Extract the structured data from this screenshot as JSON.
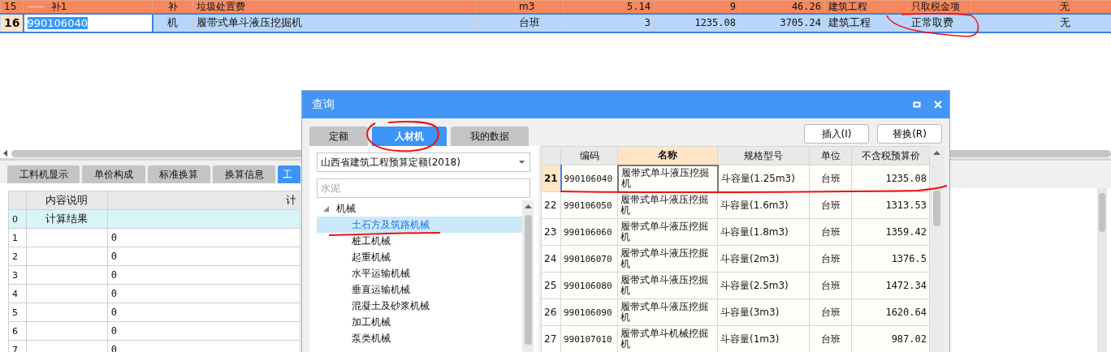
{
  "top_table": {
    "rows": [
      {
        "row_number": "15",
        "code": "补1",
        "type": "补",
        "name": "垃圾处置费",
        "unit": "m3",
        "quantity": "5.14",
        "unit_price": "9",
        "total": "46.26",
        "category": "建筑工程",
        "fee_mode": "只取税金项",
        "column_12": "无",
        "selected": false
      },
      {
        "row_number": "16",
        "code": "990106040",
        "type": "机",
        "name": "履带式单斗液压挖掘机",
        "unit": "台班",
        "quantity": "3",
        "unit_price": "1235.08",
        "total": "3705.24",
        "category": "建筑工程",
        "fee_mode": "正常取费",
        "column_12": "无",
        "selected": true
      }
    ]
  },
  "bottom_panel": {
    "tabs": [
      {
        "label": "工料机显示",
        "selected": false
      },
      {
        "label": "单价构成",
        "selected": false
      },
      {
        "label": "标准换算",
        "selected": false
      },
      {
        "label": "换算信息",
        "selected": false
      },
      {
        "label": "工",
        "selected": true
      }
    ],
    "table": {
      "columns": [
        "内容说明",
        "计"
      ],
      "rows": [
        {
          "row_number": "0",
          "description": "计算结果",
          "highlighted": true
        },
        {
          "row_number": "1",
          "value": "0",
          "highlighted": false
        },
        {
          "row_number": "2",
          "value": "0",
          "highlighted": false
        },
        {
          "row_number": "3",
          "value": "0",
          "highlighted": false
        },
        {
          "row_number": "4",
          "value": "0",
          "highlighted": false
        },
        {
          "row_number": "5",
          "value": "0",
          "highlighted": false
        },
        {
          "row_number": "6",
          "value": "0",
          "highlighted": false
        },
        {
          "row_number": "7",
          "value": "0",
          "highlighted": false
        }
      ]
    }
  },
  "dialog": {
    "title": "查询",
    "tabs": [
      {
        "label": "定额",
        "selected": false
      },
      {
        "label": "人材机",
        "selected": true
      },
      {
        "label": "我的数据",
        "selected": false
      }
    ],
    "buttons": [
      "插入(I)",
      "替换(R)"
    ],
    "library": "山西省建筑工程预算定额(2018)",
    "search": {
      "placeholder": "水泥"
    },
    "tree": [
      {
        "label": "机械",
        "expanded": true,
        "children": [
          {
            "label": "土石方及筑路机械",
            "selected": true
          },
          {
            "label": "桩工机械",
            "selected": false
          },
          {
            "label": "起重机械",
            "selected": false
          },
          {
            "label": "水平运输机械",
            "selected": false
          },
          {
            "label": "垂直运输机械",
            "selected": false
          },
          {
            "label": "混凝土及砂浆机械",
            "selected": false
          },
          {
            "label": "加工机械",
            "selected": false
          },
          {
            "label": "泵类机械",
            "selected": false
          }
        ]
      }
    ],
    "table": {
      "columns": [
        {
          "label": "编码",
          "selected": false
        },
        {
          "label": "名称",
          "selected": true
        },
        {
          "label": "规格型号",
          "selected": false
        },
        {
          "label": "单位",
          "selected": false
        },
        {
          "label": "不含税预算价",
          "selected": false
        }
      ],
      "rows": [
        {
          "row_number": "21",
          "code": "990106040",
          "name": "履带式单斗液压挖掘机",
          "spec": "斗容量(1.25m3)",
          "unit": "台班",
          "price": "1235.08",
          "selected": true
        },
        {
          "row_number": "22",
          "code": "990106050",
          "name": "履带式单斗液压挖掘机",
          "spec": "斗容量(1.6m3)",
          "unit": "台班",
          "price": "1313.53",
          "selected": false
        },
        {
          "row_number": "23",
          "code": "990106060",
          "name": "履带式单斗液压挖掘机",
          "spec": "斗容量(1.8m3)",
          "unit": "台班",
          "price": "1359.42",
          "selected": false
        },
        {
          "row_number": "24",
          "code": "990106070",
          "name": "履带式单斗液压挖掘机",
          "spec": "斗容量(2m3)",
          "unit": "台班",
          "price": "1376.5",
          "selected": false
        },
        {
          "row_number": "25",
          "code": "990106080",
          "name": "履带式单斗液压挖掘机",
          "spec": "斗容量(2.5m3)",
          "unit": "台班",
          "price": "1472.34",
          "selected": false
        },
        {
          "row_number": "26",
          "code": "990106090",
          "name": "履带式单斗液压挖掘机",
          "spec": "斗容量(3m3)",
          "unit": "台班",
          "price": "1620.64",
          "selected": false
        },
        {
          "row_number": "27",
          "code": "990107010",
          "name": "履带式单斗机械挖掘机",
          "spec": "斗容量(1m3)",
          "unit": "台班",
          "price": "987.02",
          "selected": false
        }
      ]
    }
  }
}
